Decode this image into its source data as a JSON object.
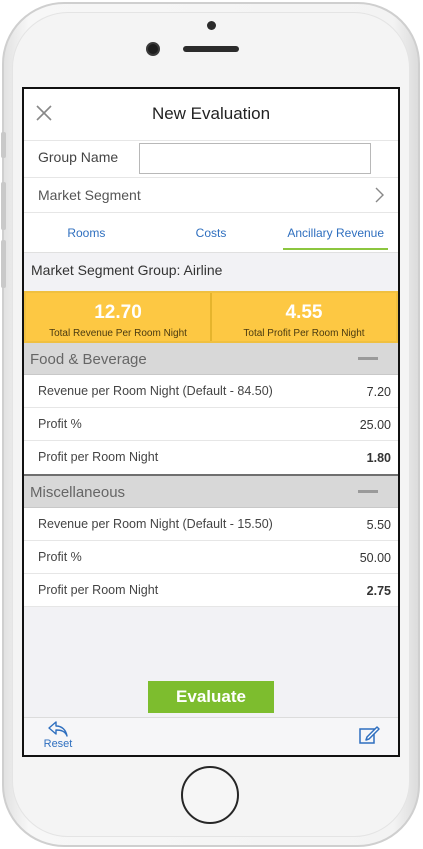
{
  "header": {
    "title": "New Evaluation",
    "close_icon": "close-icon"
  },
  "form": {
    "group_name_label": "Group Name",
    "group_name_value": "",
    "market_segment_label": "Market Segment"
  },
  "tabs": [
    {
      "label": "Rooms",
      "active": false
    },
    {
      "label": "Costs",
      "active": false
    },
    {
      "label": "Ancillary Revenue",
      "active": true
    }
  ],
  "market_segment_group": "Market Segment Group: Airline",
  "kpis": [
    {
      "value": "12.70",
      "label": "Total Revenue Per Room Night"
    },
    {
      "value": "4.55",
      "label": "Total Profit Per Room Night"
    }
  ],
  "sections": [
    {
      "title": "Food & Beverage",
      "rows": [
        {
          "label": "Revenue per Room Night (Default - 84.50)",
          "value": "7.20"
        },
        {
          "label": "Profit %",
          "value": "25.00"
        },
        {
          "label": "Profit per Room Night",
          "value": "1.80"
        }
      ]
    },
    {
      "title": "Miscellaneous",
      "rows": [
        {
          "label": "Revenue per Room Night (Default - 15.50)",
          "value": "5.50"
        },
        {
          "label": "Profit %",
          "value": "50.00"
        },
        {
          "label": "Profit per Room Night",
          "value": "2.75"
        }
      ]
    }
  ],
  "actions": {
    "evaluate_label": "Evaluate",
    "reset_label": "Reset"
  },
  "colors": {
    "accent": "#7dbd2e",
    "kpi": "#fdc843",
    "link": "#2f6fbf"
  }
}
